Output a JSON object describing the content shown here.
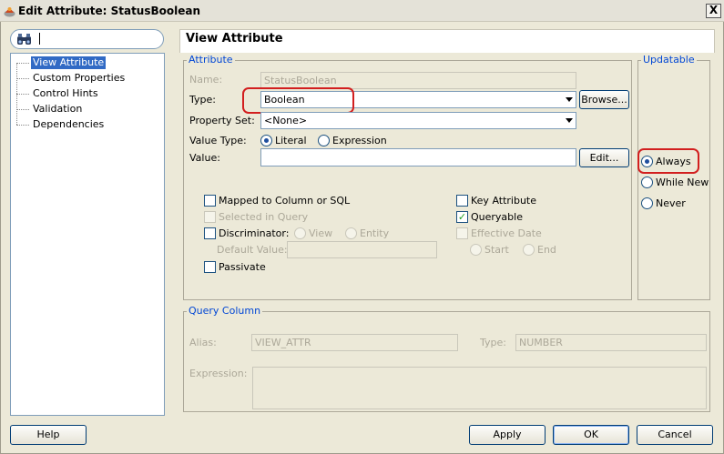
{
  "window": {
    "title": "Edit Attribute: StatusBoolean",
    "close_label": "X"
  },
  "search": {
    "placeholder": "",
    "value": ""
  },
  "nav": {
    "items": [
      {
        "label": "View Attribute",
        "selected": true
      },
      {
        "label": "Custom Properties"
      },
      {
        "label": "Control Hints"
      },
      {
        "label": "Validation"
      },
      {
        "label": "Dependencies"
      }
    ]
  },
  "page": {
    "title": "View Attribute"
  },
  "attribute": {
    "legend": "Attribute",
    "name_label": "Name:",
    "name_value": "StatusBoolean",
    "type_label": "Type:",
    "type_value": "Boolean",
    "browse_label": "Browse...",
    "property_set_label": "Property Set:",
    "property_set_value": "<None>",
    "value_type_label": "Value Type:",
    "literal_label": "Literal",
    "expression_label": "Expression",
    "value_label": "Value:",
    "value_value": "",
    "edit_label": "Edit...",
    "mapped_label": "Mapped to Column or SQL",
    "selected_in_query_label": "Selected in Query",
    "discriminator_label": "Discriminator:",
    "view_label": "View",
    "entity_label": "Entity",
    "default_value_label": "Default Value:",
    "passivate_label": "Passivate",
    "key_attribute_label": "Key Attribute",
    "queryable_label": "Queryable",
    "effective_date_label": "Effective Date",
    "start_label": "Start",
    "end_label": "End"
  },
  "updatable": {
    "legend": "Updatable",
    "always_label": "Always",
    "while_new_label": "While New",
    "never_label": "Never",
    "selected": "Always"
  },
  "query_column": {
    "legend": "Query Column",
    "alias_label": "Alias:",
    "alias_value": "VIEW_ATTR",
    "type_label": "Type:",
    "type_value": "NUMBER",
    "expression_label": "Expression:"
  },
  "buttons": {
    "help": "Help",
    "apply": "Apply",
    "ok": "OK",
    "cancel": "Cancel"
  },
  "colors": {
    "selection": "#316ac5",
    "legend": "#0046d5",
    "highlight": "#d21f1f"
  }
}
